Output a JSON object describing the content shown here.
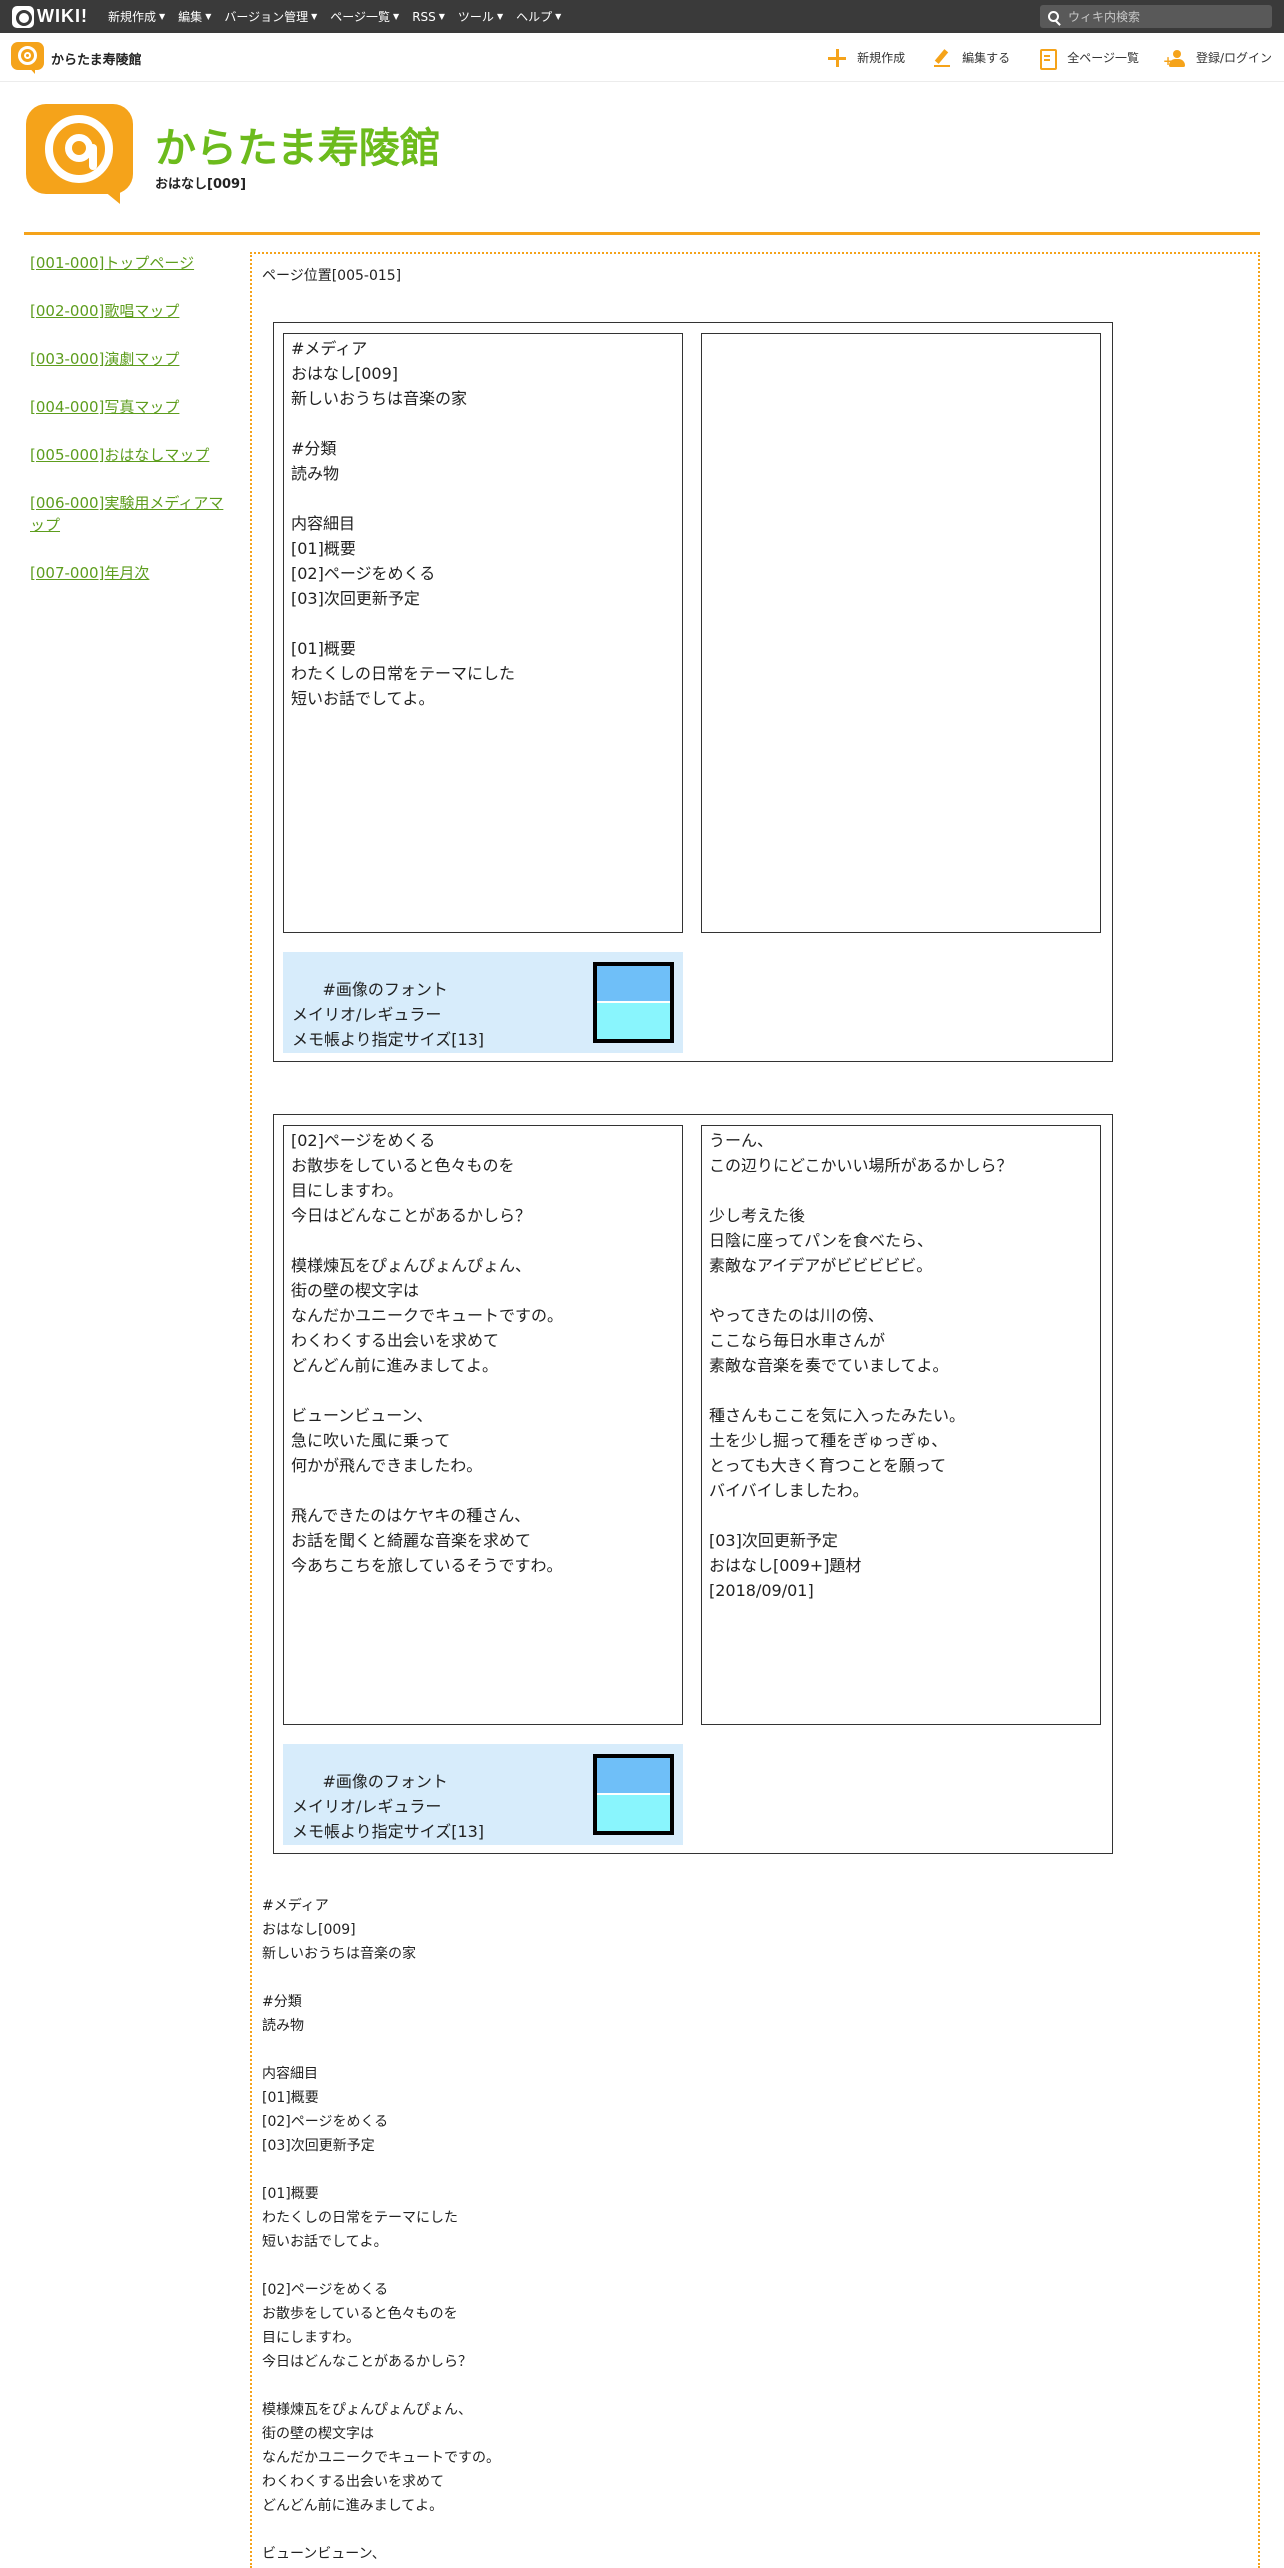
{
  "topbar": {
    "logo_text": "WIKI!",
    "menu": [
      "新規作成",
      "編集",
      "バージョン管理",
      "ページ一覧",
      "RSS",
      "ツール",
      "ヘルプ"
    ],
    "search_placeholder": "ウィキ内検索"
  },
  "subbar": {
    "site_name": "からたま寿陵館",
    "actions": {
      "new": "新規作成",
      "edit": "編集する",
      "all_pages": "全ページ一覧",
      "login": "登録/ログイン"
    }
  },
  "header": {
    "title": "からたま寿陵館",
    "subtitle": "おはなし[009]"
  },
  "sidebar": {
    "items": [
      "[001-000]トップページ",
      "[002-000]歌唱マップ",
      "[003-000]演劇マップ",
      "[004-000]写真マップ",
      "[005-000]おはなしマップ",
      "[006-000]実験用メディアマップ",
      "[007-000]年月次"
    ]
  },
  "main": {
    "position_label": "ページ位置[005-015]",
    "table1": {
      "left_text": "#メディア\nおはなし[009]\n新しいおうちは音楽の家\n\n#分類\n読み物\n\n内容細目\n[01]概要\n[02]ページをめくる\n[03]次回更新予定\n\n[01]概要\nわたくしの日常をテーマにした\n短いお話でしてよ。",
      "right_text": "",
      "font_note": "#画像のフォント\nメイリオ/レギュラー\nメモ帳より指定サイズ[13]"
    },
    "table2": {
      "left_text": "[02]ページをめくる\nお散歩をしていると色々ものを\n目にしますわ。\n今日はどんなことがあるかしら？\n\n模様煉瓦をぴょんぴょんぴょん、\n街の壁の楔文字は\nなんだかユニークでキュートですの。\nわくわくする出会いを求めて\nどんどん前に進みましてよ。\n\nビューンビューン、\n急に吹いた風に乗って\n何かが飛んできましたわ。\n\n飛んできたのはケヤキの種さん、\nお話を聞くと綺麗な音楽を求めて\n今あちこちを旅しているそうですわ。",
      "right_text": "うーん、\nこの辺りにどこかいい場所があるかしら？\n\n少し考えた後\n日陰に座ってパンを食べたら、\n素敵なアイデアがビビビビビ。\n\nやってきたのは川の傍、\nここなら毎日水車さんが\n素敵な音楽を奏でていましてよ。\n\n種さんもここを気に入ったみたい。\n土を少し掘って種をぎゅっぎゅ、\nとっても大きく育つことを願って\nバイバイしましたわ。\n\n[03]次回更新予定\nおはなし[009+]題材\n[2018/09/01]",
      "font_note": "#画像のフォント\nメイリオ/レギュラー\nメモ帳より指定サイズ[13]"
    },
    "plain_text": "#メディア\nおはなし[009]\n新しいおうちは音楽の家\n\n#分類\n読み物\n\n内容細目\n[01]概要\n[02]ページをめくる\n[03]次回更新予定\n\n[01]概要\nわたくしの日常をテーマにした\n短いお話でしてよ。\n\n[02]ページをめくる\nお散歩をしていると色々ものを\n目にしますわ。\n今日はどんなことがあるかしら？\n\n模様煉瓦をぴょんぴょんぴょん、\n街の壁の楔文字は\nなんだかユニークでキュートですの。\nわくわくする出会いを求めて\nどんどん前に進みましてよ。\n\nビューンビューン、"
  },
  "colors": {
    "brand_orange": "#f5a31a",
    "title_green": "#6cbb1c",
    "link_green": "#5d9d1d",
    "topbar_bg": "#3a3a3a",
    "fontbox_bg": "#d7ecfb"
  }
}
